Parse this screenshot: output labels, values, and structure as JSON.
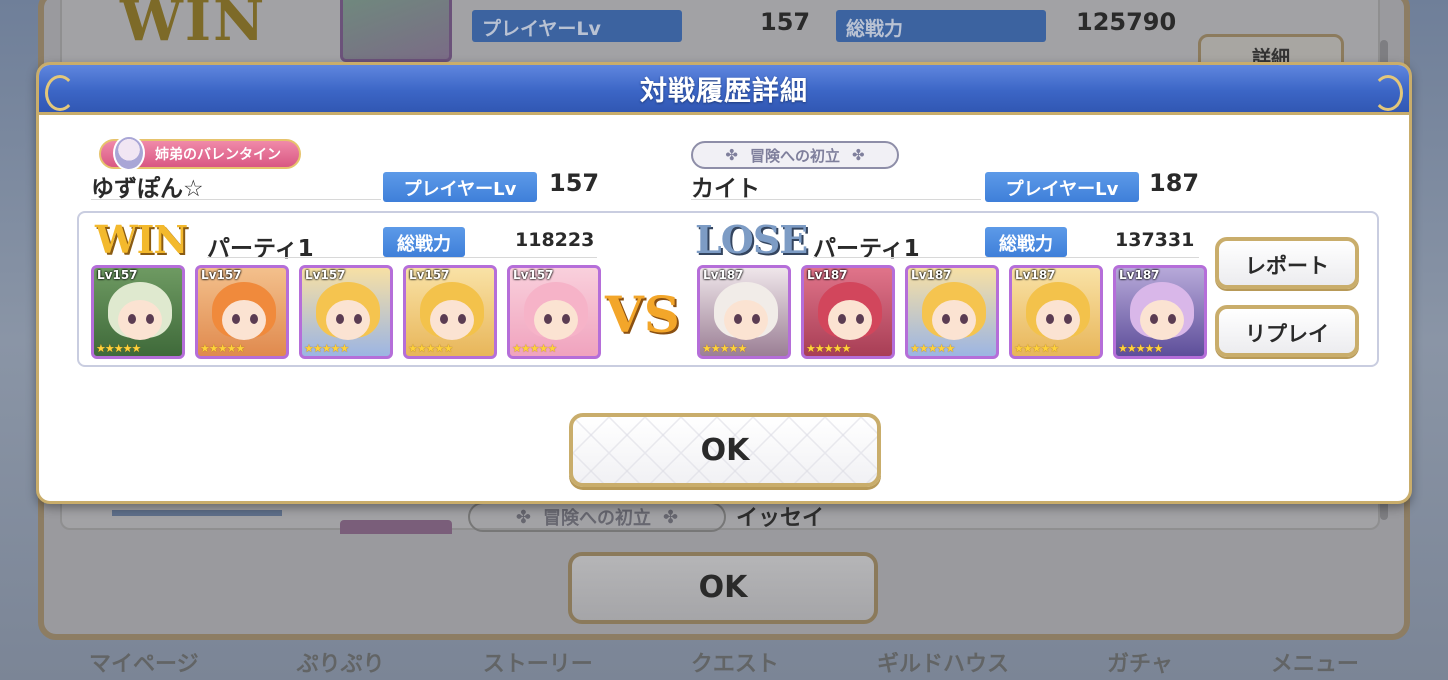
{
  "background": {
    "result_label": "WIN",
    "player_lv_label": "プレイヤーLv",
    "player_lv_value": "157",
    "total_power_label": "総戦力",
    "total_power_value": "125790",
    "detail_button": "詳細",
    "title_badge": "冒険への初立",
    "opponent_name": "イッセイ",
    "ok_button": "OK",
    "nav_items": [
      "マイページ",
      "ぷりぷり",
      "ストーリー",
      "クエスト",
      "ギルドハウス",
      "ガチャ",
      "メニュー"
    ]
  },
  "dialog": {
    "title": "対戦履歴詳細",
    "ok_button": "OK",
    "vs_label": "VS",
    "report_button": "レポート",
    "replay_button": "リプレイ",
    "player": {
      "title_badge": "姉弟のバレンタイン",
      "name": "ゆずぽん☆",
      "lv_label": "プレイヤーLv",
      "lv_value": "157",
      "result": "WIN",
      "party_name": "パーティ1",
      "power_label": "総戦力",
      "power_value": "118223",
      "units": [
        {
          "lv": "Lv157",
          "stars": "★★★★★",
          "color_top": "#6e9a62",
          "color_bottom": "#3f6a3a",
          "hair": "#dfe9cf"
        },
        {
          "lv": "Lv157",
          "stars": "★★★★★",
          "color_top": "#f3c08c",
          "color_bottom": "#e08a4e",
          "hair": "#f08a3c"
        },
        {
          "lv": "Lv157",
          "stars": "★★★★★",
          "color_top": "#f7e0a4",
          "color_bottom": "#9cb5e3",
          "hair": "#f5c44f"
        },
        {
          "lv": "Lv157",
          "stars": "★★★★★",
          "color_top": "#f9e2a6",
          "color_bottom": "#e8b65a",
          "hair": "#f3c24b"
        },
        {
          "lv": "Lv157",
          "stars": "★★★★★",
          "color_top": "#f9d0dc",
          "color_bottom": "#f0a3be",
          "hair": "#f6b3c8"
        }
      ]
    },
    "opponent": {
      "title_badge": "冒険への初立",
      "name": "カイト",
      "lv_label": "プレイヤーLv",
      "lv_value": "187",
      "result": "LOSE",
      "party_name": "パーティ1",
      "power_label": "総戦力",
      "power_value": "137331",
      "units": [
        {
          "lv": "Lv187",
          "stars": "★★★★★",
          "color_top": "#efe6ea",
          "color_bottom": "#9b7f95",
          "hair": "#f1ece8"
        },
        {
          "lv": "Lv187",
          "stars": "★★★★★",
          "color_top": "#e0748a",
          "color_bottom": "#a83e55",
          "hair": "#d2465c"
        },
        {
          "lv": "Lv187",
          "stars": "★★★★★",
          "color_top": "#f7e0a4",
          "color_bottom": "#9cb5e3",
          "hair": "#f5c44f"
        },
        {
          "lv": "Lv187",
          "stars": "★★★★★",
          "color_top": "#f9e2a6",
          "color_bottom": "#e8b65a",
          "hair": "#f3c24b"
        },
        {
          "lv": "Lv187",
          "stars": "★★★★★",
          "color_top": "#b7a9d9",
          "color_bottom": "#5d4e9a",
          "hair": "#d9b7e9"
        }
      ]
    }
  }
}
